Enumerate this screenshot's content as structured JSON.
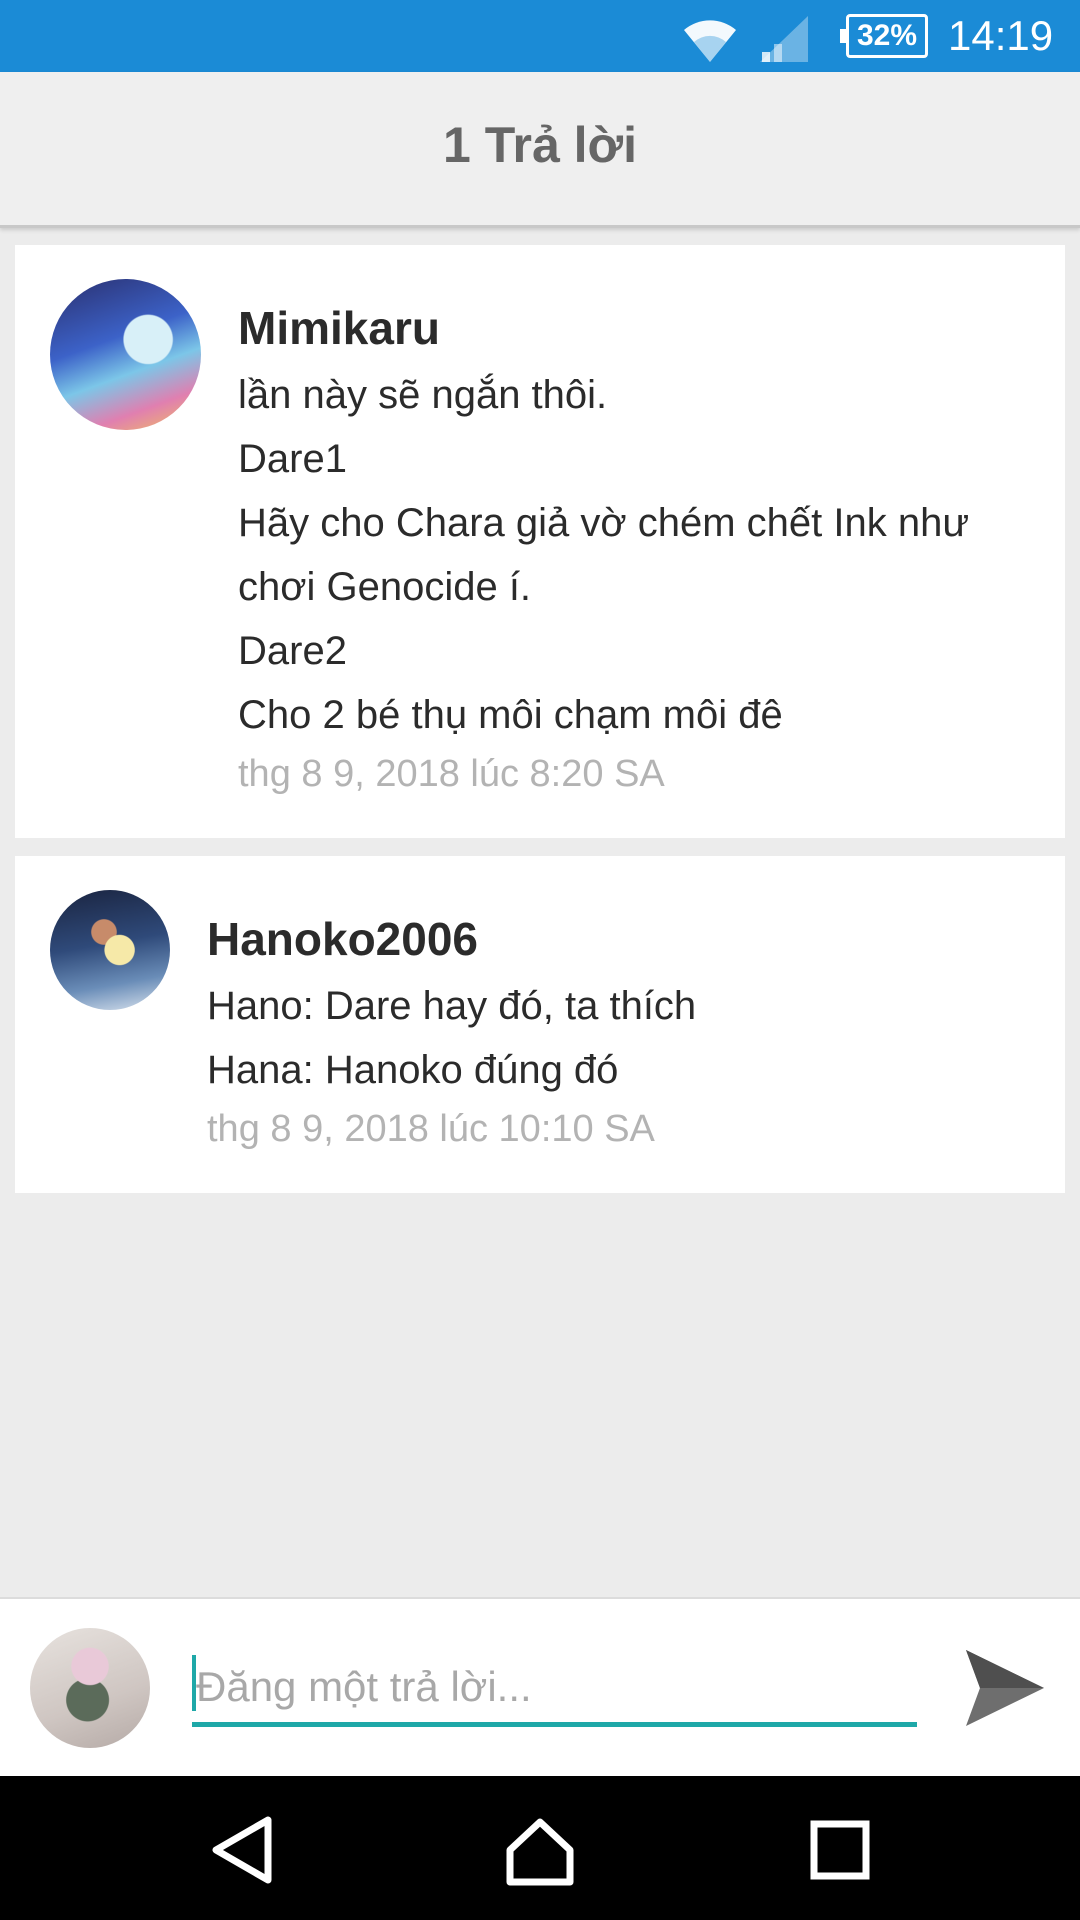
{
  "status_bar": {
    "battery": "32%",
    "time": "14:19",
    "bar_color": "#1b8bd6"
  },
  "header": {
    "title": "1 Trả lời"
  },
  "comments": [
    {
      "author": "Mimikaru",
      "lines": [
        "lần này sẽ ngắn thôi.",
        "Dare1",
        "Hãy cho Chara giả vờ chém chết Ink như",
        "chơi Genocide í.",
        "Dare2",
        "Cho 2 bé thụ môi chạm môi đê"
      ],
      "timestamp": "thg 8 9, 2018 lúc 8:20 SA"
    },
    {
      "author": "Hanoko2006",
      "lines": [
        "Hano: Dare hay đó, ta thích",
        "Hana: Hanoko đúng đó"
      ],
      "timestamp": "thg 8 9, 2018 lúc 10:10 SA"
    }
  ],
  "reply": {
    "placeholder": "Đăng một trả lời...",
    "value": "",
    "accent_color": "#1ea8a8"
  },
  "icons": {
    "wifi": "wifi-icon",
    "signal": "signal-icon",
    "battery": "battery-icon",
    "send": "send-icon",
    "back": "back-icon",
    "home": "home-icon",
    "recent": "recent-apps-icon"
  }
}
